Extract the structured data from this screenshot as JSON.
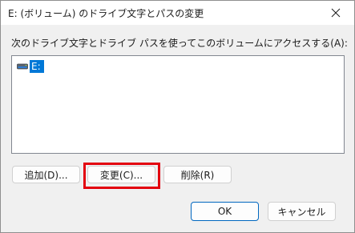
{
  "window": {
    "title": "E: (ボリューム) のドライブ文字とパスの変更",
    "close_icon": "close-icon"
  },
  "dialog": {
    "instruction": "次のドライブ文字とドライブ パスを使ってこのボリュームにアクセスする(A):",
    "list_items": [
      {
        "label": "E:",
        "icon": "drive-icon",
        "selected": true
      }
    ],
    "buttons": {
      "add": "追加(D)...",
      "change": "変更(C)...",
      "remove": "削除(R)",
      "ok": "OK",
      "cancel": "キャンセル"
    },
    "highlight_color": "#e3000f",
    "selection_color": "#0078d7"
  }
}
